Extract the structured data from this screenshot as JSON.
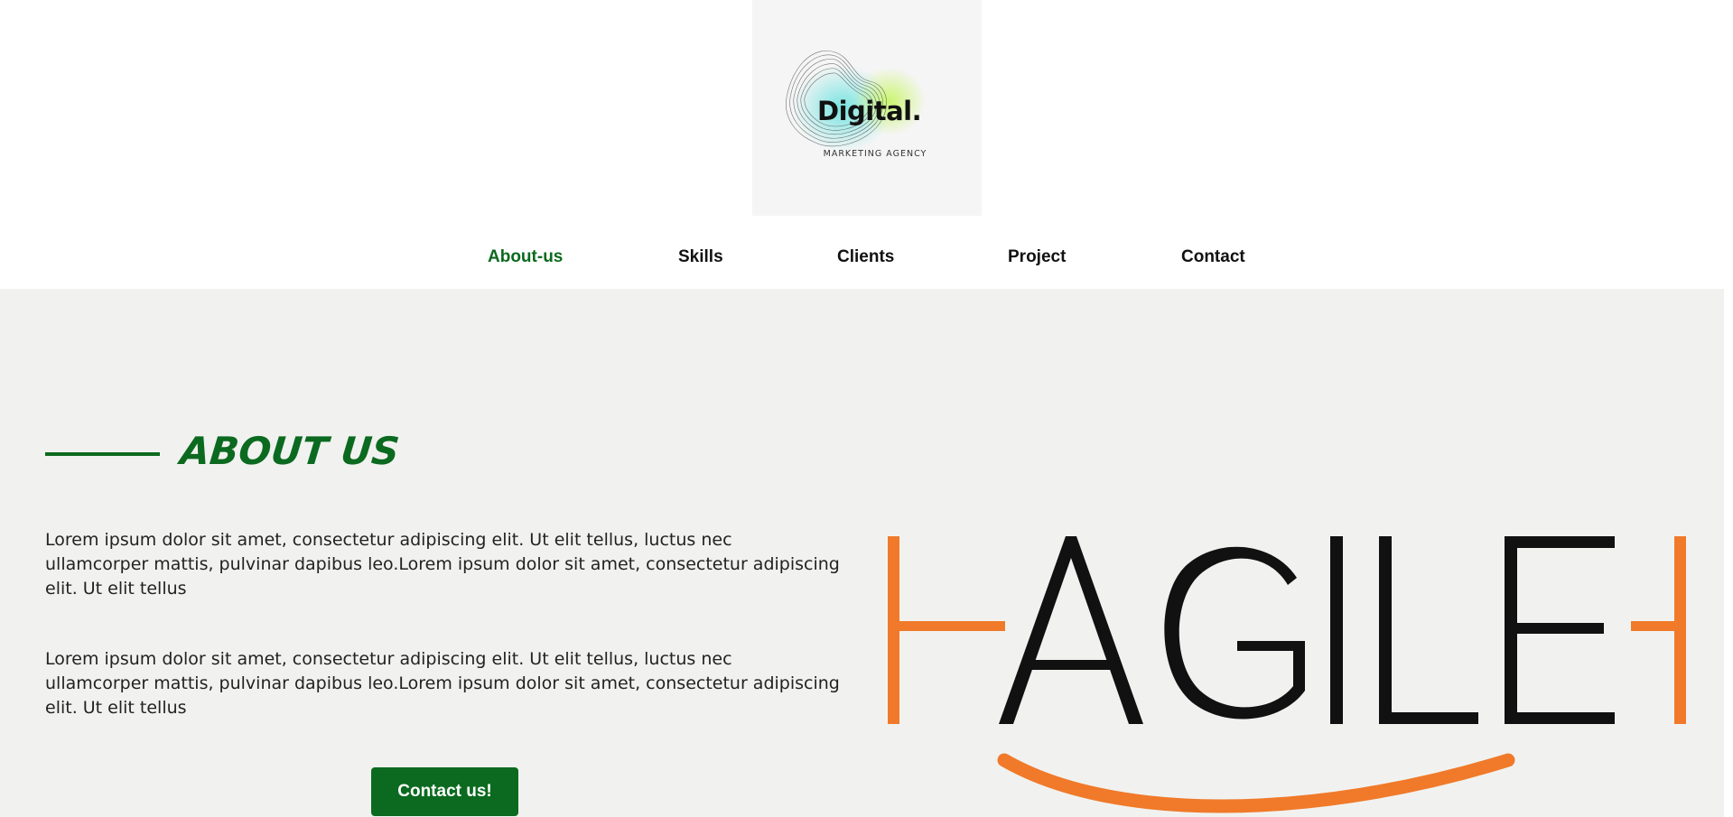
{
  "header": {
    "logo": {
      "title": "Digital.",
      "subtitle": "MARKETING AGENCY"
    },
    "nav": [
      {
        "label": "About-us",
        "active": true
      },
      {
        "label": "Skills",
        "active": false
      },
      {
        "label": "Clients",
        "active": false
      },
      {
        "label": "Project",
        "active": false
      },
      {
        "label": "Contact",
        "active": false
      }
    ]
  },
  "about": {
    "title": "ABOUT US",
    "paragraphs": [
      "Lorem ipsum dolor sit amet, consectetur adipiscing elit. Ut elit tellus, luctus nec ullamcorper mattis, pulvinar dapibus leo.Lorem ipsum dolor sit amet, consectetur adipiscing elit. Ut elit tellus",
      "Lorem ipsum dolor sit amet, consectetur adipiscing elit. Ut elit tellus, luctus nec ullamcorper mattis, pulvinar dapibus leo.Lorem ipsum dolor sit amet, consectetur adipiscing elit. Ut elit tellus"
    ],
    "cta_label": "Contact us!",
    "image_logo_text": "AGILE"
  },
  "colors": {
    "brand_green": "#0b6a1f",
    "section_bg": "#f1f2f0",
    "agile_orange": "#f07a2a",
    "agile_black": "#111111"
  }
}
